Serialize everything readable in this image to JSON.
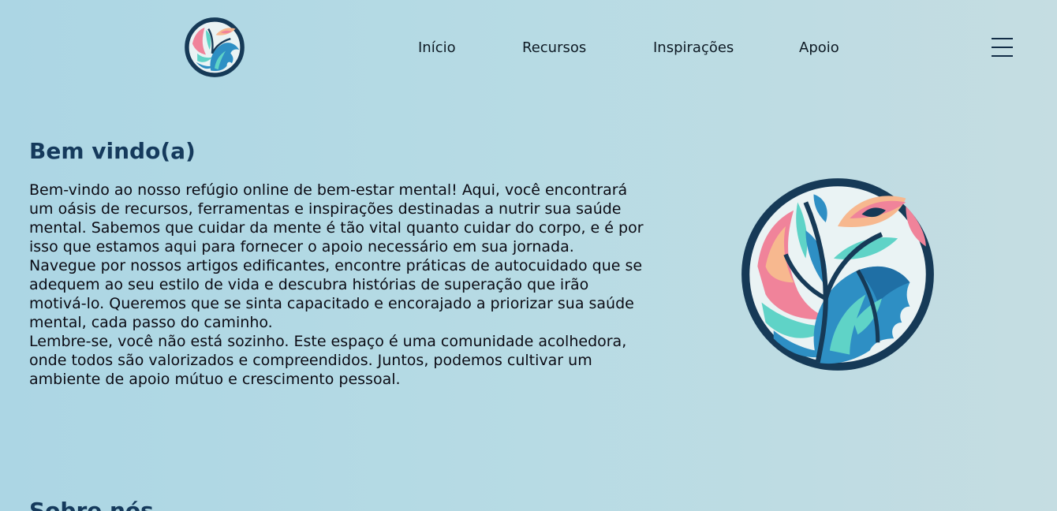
{
  "header": {
    "logo_icon": "brain-leaf-logo-icon",
    "nav": [
      {
        "label": "Início"
      },
      {
        "label": "Recursos"
      },
      {
        "label": "Inspirações"
      },
      {
        "label": "Apoio"
      }
    ],
    "menu_icon": "hamburger-menu-icon"
  },
  "welcome": {
    "title": "Bem vindo(a)",
    "paragraphs": [
      "Bem-vindo ao nosso refúgio online de bem-estar mental! Aqui, você encontrará um oásis de recursos, ferramentas e inspirações destinadas a nutrir sua saúde mental. Sabemos que cuidar da mente é tão vital quanto cuidar do corpo, e é por isso que estamos aqui para fornecer o apoio necessário em sua jornada.",
      "Navegue por nossos artigos edificantes, encontre práticas de autocuidado que se adequem ao seu estilo de vida e descubra histórias de superação que irão motivá-lo. Queremos que se sinta capacitado e encorajado a priorizar sua saúde mental, cada passo do caminho.",
      "Lembre-se, você não está sozinho. Este espaço é uma comunidade acolhedora, onde todos são valorizados e compreendidos. Juntos, podemos cultivar um ambiente de apoio mútuo e crescimento pessoal."
    ],
    "image_icon": "brain-leaf-illustration-icon"
  },
  "next_section": {
    "title": "Sobre nós"
  },
  "colors": {
    "background_left": "#acd6e4",
    "background_right": "#c5dde2",
    "heading": "#153a5c",
    "logo_ring": "#163a57",
    "leaf_blue": "#2e8fc4",
    "leaf_teal": "#5fd3c7",
    "leaf_pink": "#f0839a",
    "leaf_peach": "#f7b88f"
  }
}
